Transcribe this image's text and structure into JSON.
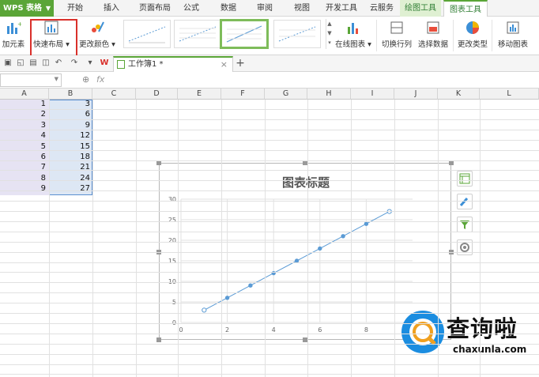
{
  "app": {
    "name": "WPS 表格"
  },
  "menu_tabs": [
    "开始",
    "插入",
    "页面布局",
    "公式",
    "数据",
    "审阅",
    "视图",
    "开发工具",
    "云服务",
    "绘图工具",
    "图表工具"
  ],
  "ribbon": {
    "add_element": "加元素",
    "quick_layout": "快速布局",
    "change_color": "更改颜色",
    "online_chart": "在线图表",
    "switch_row_col": "切换行列",
    "select_data": "选择数据",
    "change_type": "更改类型",
    "move_chart": "移动图表"
  },
  "document": {
    "tab_title": "工作簿1 *"
  },
  "formula_bar": {
    "fx": "fx"
  },
  "columns": [
    "A",
    "B",
    "C",
    "D",
    "E",
    "F",
    "G",
    "H",
    "I",
    "J",
    "K",
    "L"
  ],
  "sheet_data": {
    "col_a": [
      "1",
      "2",
      "3",
      "4",
      "5",
      "6",
      "7",
      "8",
      "9"
    ],
    "col_b": [
      "3",
      "6",
      "9",
      "12",
      "15",
      "18",
      "21",
      "24",
      "27"
    ]
  },
  "chart_data": {
    "type": "line",
    "title": "图表标题",
    "x": [
      1,
      2,
      3,
      4,
      5,
      6,
      7,
      8,
      9
    ],
    "series": [
      {
        "values": [
          3,
          6,
          9,
          12,
          15,
          18,
          21,
          24,
          27
        ]
      }
    ],
    "xlim": [
      0,
      10
    ],
    "ylim": [
      0,
      30
    ],
    "x_ticks": [
      0,
      2,
      4,
      6,
      8
    ],
    "y_ticks": [
      0,
      5,
      10,
      15,
      20,
      25,
      30
    ],
    "grid": true,
    "color": "#5b9bd5"
  },
  "chart_tools": [
    "elements-icon",
    "style-brush-icon",
    "filter-icon",
    "settings-icon"
  ],
  "watermark": {
    "text": "查询啦",
    "url": "chaxunla.com"
  },
  "colors": {
    "accent": "#5aa537",
    "highlight": "#d9302b",
    "series": "#5b9bd5"
  }
}
